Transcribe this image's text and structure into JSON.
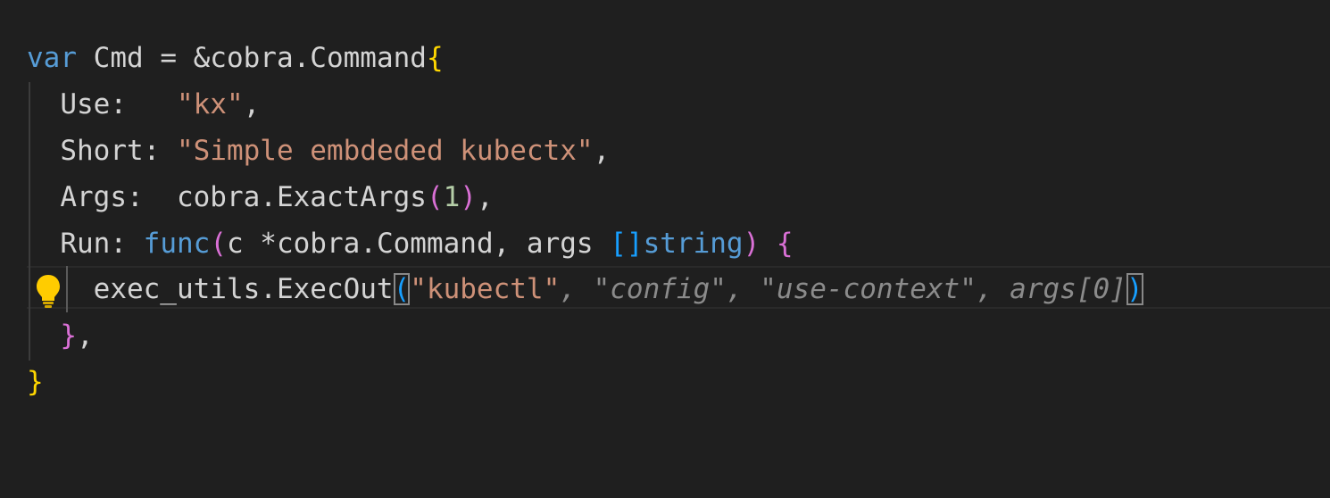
{
  "editor": {
    "language": "go",
    "code_lines": [
      {
        "text": "var Cmd = &cobra.Command{"
      },
      {
        "text": "  Use:   \"kx\","
      },
      {
        "text": "  Short: \"Simple embdeded kubectx\","
      },
      {
        "text": "  Args:  cobra.ExactArgs(1),"
      },
      {
        "text": "  Run: func(c *cobra.Command, args []string) {"
      },
      {
        "text": "    exec_utils.ExecOut(\"kubectl\", \"config\", \"use-context\", args[0])"
      },
      {
        "text": "  },"
      },
      {
        "text": "}"
      }
    ],
    "tokens": {
      "l1_var": "var",
      "l1_rest": " Cmd = &cobra.Command",
      "l1_brace": "{",
      "l2_key": "Use:   ",
      "l2_str": "\"kx\"",
      "l2_comma": ",",
      "l3_key": "Short: ",
      "l3_str": "\"Simple embdeded kubectx\"",
      "l3_comma": ",",
      "l4_key": "Args:  cobra.ExactArgs",
      "l4_open": "(",
      "l4_num": "1",
      "l4_close": ")",
      "l4_comma": ",",
      "l5_key": "Run: ",
      "l5_func": "func",
      "l5_open": "(",
      "l5_params_a": "c *cobra.Command, args ",
      "l5_sq": "[]",
      "l5_string": "string",
      "l5_close": ")",
      "l5_space": " ",
      "l5_brace": "{",
      "l6_call": "exec_utils.ExecOut",
      "l6_open": "(",
      "l6_str": "\"kubectl\"",
      "l6_ghost": ", \"config\", \"use-context\", args[0]",
      "l6_close": ")",
      "l7_brace": "}",
      "l7_comma": ",",
      "l8_brace": "}"
    },
    "lightbulb_icon": "lightbulb-icon",
    "colors": {
      "background": "#1f1f1f",
      "keyword": "#569cd6",
      "string": "#ce9178",
      "number": "#b5cea8",
      "bracket_level1": "#ffd700",
      "bracket_level2": "#da70d6",
      "bracket_level3": "#179fff",
      "inline_suggestion": "#8b8b8b",
      "lightbulb": "#ffcc00"
    }
  }
}
